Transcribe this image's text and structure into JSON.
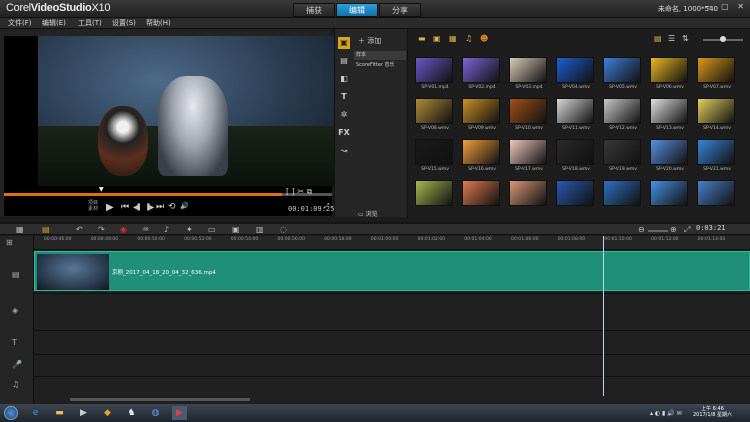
{
  "app": {
    "logo_prefix": "Corel",
    "logo_name": "VideoStudio",
    "logo_version": "X10"
  },
  "modes": [
    {
      "label": "捕获"
    },
    {
      "label": "编辑"
    },
    {
      "label": "分享"
    }
  ],
  "project_info": "未命名, 1000*540",
  "window_controls": "— ▢ ✕",
  "menu": [
    "文件(F)",
    "编辑(E)",
    "工具(T)",
    "设置(S)",
    "帮助(H)"
  ],
  "player": {
    "project_label": "项目",
    "clip_label": "素材",
    "timecode": "00:01:09:25",
    "controls": {
      "play": "▶",
      "home": "⏮",
      "prev": "◀▌",
      "next": "▐▶",
      "end": "⏭",
      "repeat": "⟲",
      "volume": "🔊",
      "size": "⤢"
    }
  },
  "library": {
    "add_label": "添加",
    "folders": [
      "样本",
      "ScoreFitter 音乐"
    ],
    "browse_label": "浏览",
    "options_label": "选项",
    "thumbnails": [
      {
        "label": "SP-V01.mp4",
        "color": "#6a58c8"
      },
      {
        "label": "SP-V02.mp4",
        "color": "#7a66d8"
      },
      {
        "label": "SP-V03.mp4",
        "color": "#d8ccb8"
      },
      {
        "label": "SP-V04.wmv",
        "color": "#1d5fd0"
      },
      {
        "label": "SP-V05.wmv",
        "color": "#3f7fd8"
      },
      {
        "label": "SP-V06.wmv",
        "color": "#e8b820"
      },
      {
        "label": "SP-V07.wmv",
        "color": "#d89a18"
      },
      {
        "label": "SP-V08.wmv",
        "color": "#b08a3a"
      },
      {
        "label": "SP-V09.wmv",
        "color": "#c89028"
      },
      {
        "label": "SP-V10.wmv",
        "color": "#a0521c"
      },
      {
        "label": "SP-V11.wmv",
        "color": "#d8d8d8"
      },
      {
        "label": "SP-V12.wmv",
        "color": "#c8c8c8"
      },
      {
        "label": "SP-V13.wmv",
        "color": "#e0e0e0"
      },
      {
        "label": "SP-V14.wmv",
        "color": "#e0d060"
      },
      {
        "label": "SP-V15.wmv",
        "color": "#1a1a1a"
      },
      {
        "label": "SP-V16.wmv",
        "color": "#f0a040"
      },
      {
        "label": "SP-V17.wmv",
        "color": "#f0c8c0"
      },
      {
        "label": "SP-V18.wmv",
        "color": "#2a2a2a"
      },
      {
        "label": "SP-V19.wmv",
        "color": "#383838"
      },
      {
        "label": "SP-V20.wmv",
        "color": "#5a90e0"
      },
      {
        "label": "SP-V21.wmv",
        "color": "#3a86d8"
      },
      {
        "label": "",
        "color": "#a8b850"
      },
      {
        "label": "",
        "color": "#e07a50"
      },
      {
        "label": "",
        "color": "#d89878"
      },
      {
        "label": "",
        "color": "#2a5ab0"
      },
      {
        "label": "",
        "color": "#3070c0"
      },
      {
        "label": "",
        "color": "#4890e0"
      },
      {
        "label": "",
        "color": "#4a80c8"
      }
    ]
  },
  "timeline": {
    "timecode": "0:03:21",
    "ruler": [
      "00:00:46:00",
      "00:00:48:00",
      "00:00:50:00",
      "00:00:52:00",
      "00:00:54:00",
      "00:00:56:00",
      "00:00:58:00",
      "00:01:00:00",
      "00:01:02:00",
      "00:01:04:00",
      "00:01:06:00",
      "00:01:08:00",
      "00:01:10:00",
      "00:01:12:00",
      "00:01:14:00"
    ],
    "clip_name": "京剧_2017_04_18_20_04_32_636.mp4",
    "clip_color": "#1f8f77"
  },
  "taskbar": {
    "clock_time": "上午 6:46",
    "clock_date": "2017/1/8 星期六"
  }
}
